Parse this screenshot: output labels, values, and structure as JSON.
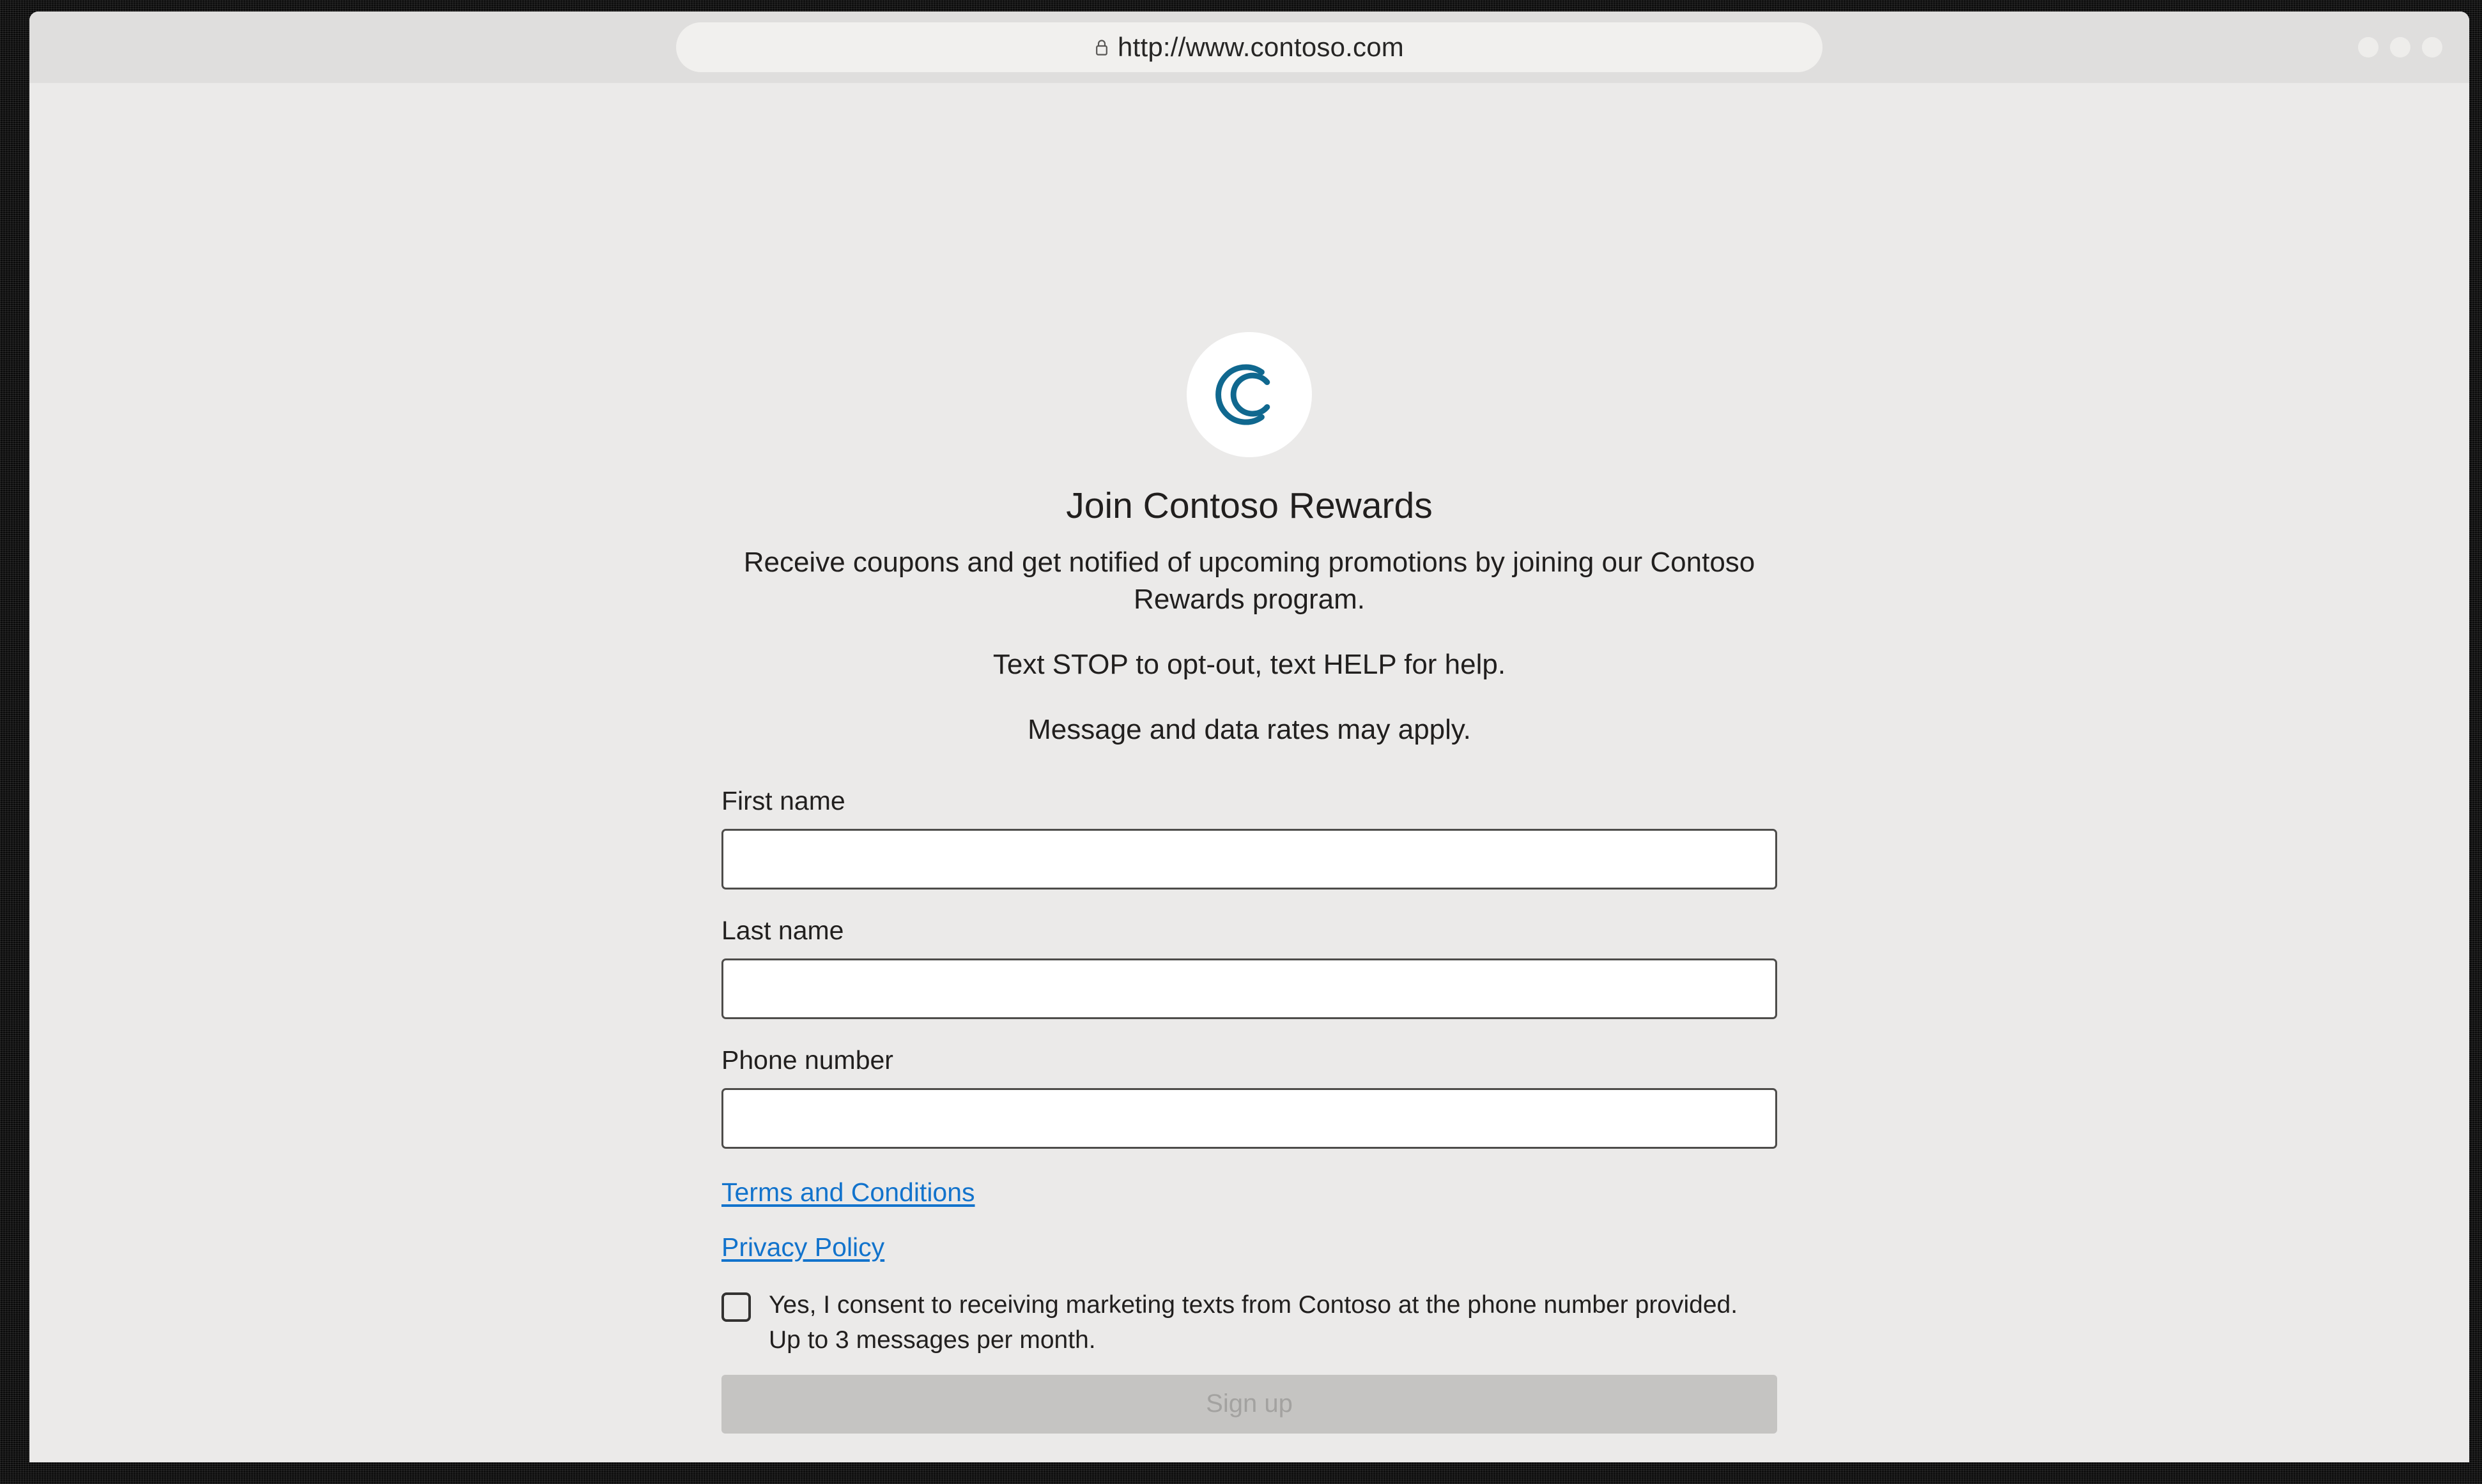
{
  "browser": {
    "url": "http://www.contoso.com",
    "lock_icon": "lock-icon",
    "window_controls": [
      "minimize-dot",
      "maximize-dot",
      "close-dot"
    ]
  },
  "brand": {
    "logo_icon": "contoso-double-c-logo",
    "logo_color": "#10688f",
    "logo_background": "#ffffff"
  },
  "page": {
    "title": "Join Contoso Rewards",
    "intro_paragraph": "Receive coupons and get notified of upcoming promotions by joining our Contoso Rewards program.",
    "intro_stop": "Text STOP to opt-out, text HELP for help.",
    "intro_rates": "Message and data rates may apply.",
    "background_color": "#ebeae9"
  },
  "form": {
    "fields": [
      {
        "label": "First name",
        "value": "",
        "placeholder": ""
      },
      {
        "label": "Last name",
        "value": "",
        "placeholder": ""
      },
      {
        "label": "Phone number",
        "value": "",
        "placeholder": ""
      }
    ],
    "links": [
      {
        "label": "Terms and Conditions",
        "color": "#1273cc"
      },
      {
        "label": "Privacy Policy",
        "color": "#1273cc"
      }
    ],
    "consent": {
      "checked": false,
      "text": "Yes, I consent to receiving marketing texts from Contoso at the phone number provided. Up to 3 messages per month."
    },
    "submit": {
      "label": "Sign up",
      "disabled": true,
      "background_color": "#c5c4c2",
      "text_color": "#a3a2a0"
    }
  }
}
